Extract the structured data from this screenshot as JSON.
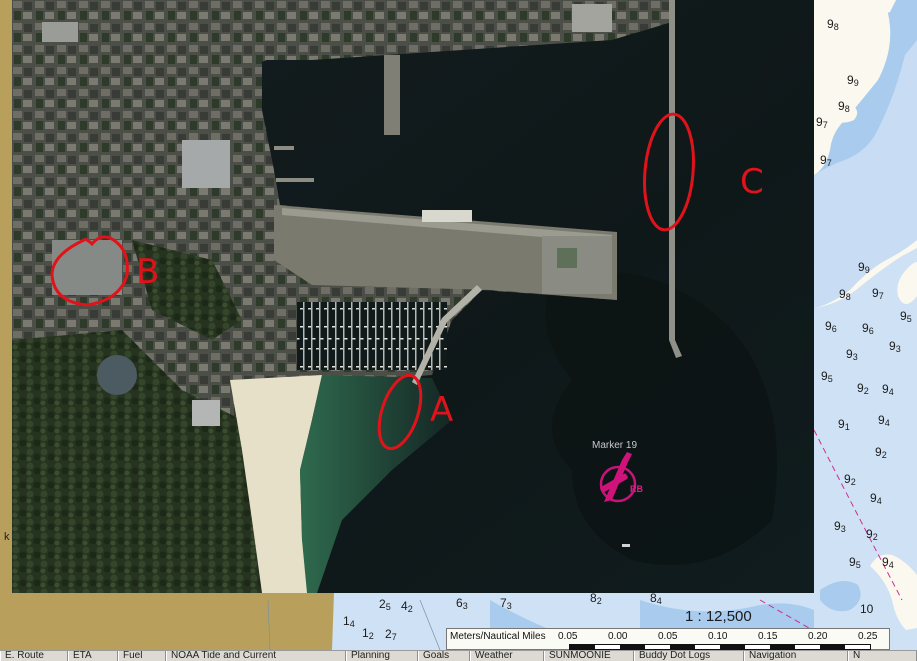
{
  "marker": {
    "name": "Marker 19",
    "code": "RB"
  },
  "annotations": {
    "a": "A",
    "b": "B",
    "c": "C"
  },
  "edge_label": "k",
  "scale": {
    "ratio": "1 : 12,500",
    "title": "Meters/Nautical Miles",
    "ticks": [
      "0.05",
      "0.00",
      "0.05",
      "0.10",
      "0.15",
      "0.20",
      "0.25"
    ]
  },
  "soundings": {
    "s1": "9",
    "s1b": "8",
    "s2": "9",
    "s2b": "9",
    "s3": "9",
    "s3b": "8",
    "s4": "9",
    "s4b": "7",
    "s5": "9",
    "s5b": "7",
    "s6": "9",
    "s6b": "9",
    "s7": "9",
    "s7b": "8",
    "s8": "9",
    "s8b": "7",
    "s9": "9",
    "s9b": "6",
    "s10": "9",
    "s10b": "6",
    "s11": "9",
    "s11b": "5",
    "s12": "9",
    "s12b": "3",
    "s13": "9",
    "s13b": "3",
    "s14": "9",
    "s14b": "5",
    "s15": "9",
    "s15b": "2",
    "s16": "9",
    "s16b": "4",
    "s17": "9",
    "s17b": "1",
    "s18": "9",
    "s18b": "4",
    "s19": "9",
    "s19b": "2",
    "s20": "9",
    "s20b": "2",
    "s21": "9",
    "s21b": "4",
    "s22": "9",
    "s22b": "3",
    "s23": "9",
    "s23b": "2",
    "s24": "9",
    "s24b": "5",
    "s25": "9",
    "s25b": "4",
    "s26": "10",
    "b1": "2",
    "b1b": "5",
    "b2": "4",
    "b2b": "2",
    "b3": "6",
    "b3b": "3",
    "b4": "7",
    "b4b": "3",
    "b5": "1",
    "b5b": "4",
    "b6": "1",
    "b6b": "2",
    "b7": "2",
    "b7b": "7",
    "b8": "8",
    "b8b": "2",
    "b9": "8",
    "b9b": "4"
  },
  "tabs": [
    "E. Route",
    "ETA",
    "Fuel",
    "NOAA Tide and Current",
    "Planning",
    "Goals",
    "Weather",
    "SUNMOONIE",
    "Buddy Dot Logs",
    "Navigation",
    "N"
  ],
  "colors": {
    "land": "#fdfaf2",
    "shallow": "#a6c9ee",
    "deep": "#d5e6f7",
    "brown": "#b7a15c",
    "annotation": "#e0131b",
    "marker": "#d0137a"
  }
}
